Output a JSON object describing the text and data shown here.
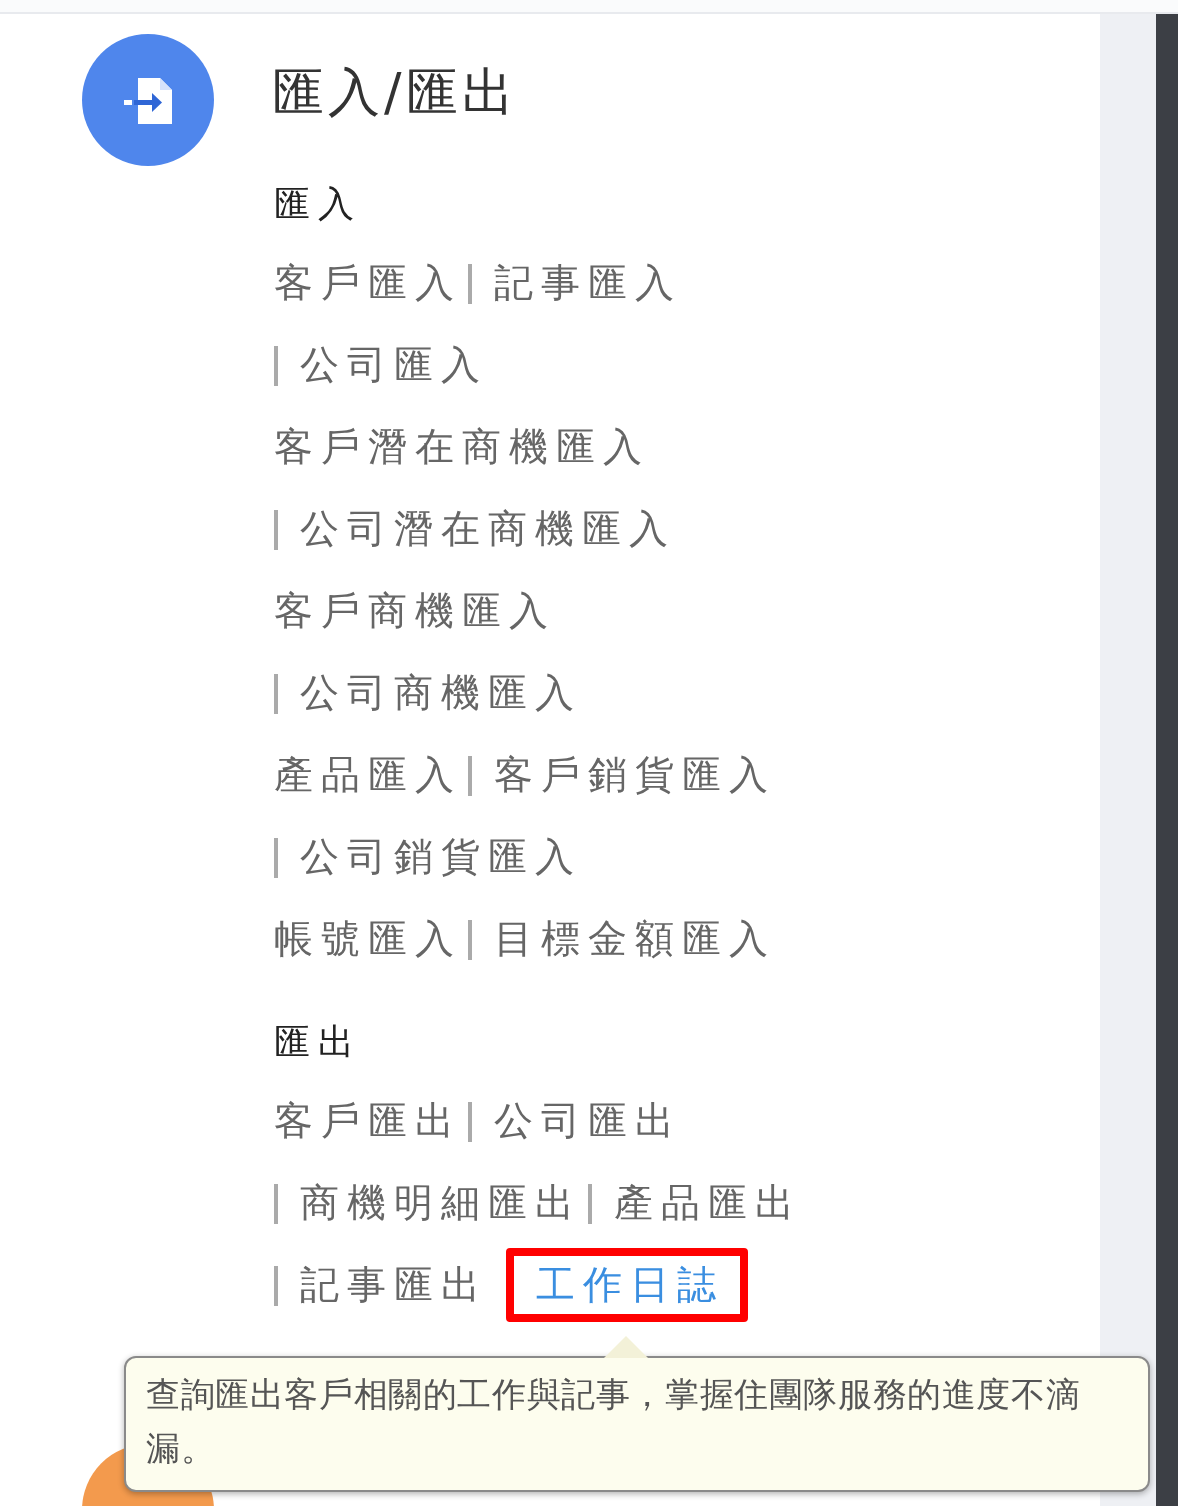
{
  "section": {
    "title": "匯入/匯出",
    "groups": [
      {
        "heading": "匯入",
        "lines": [
          {
            "links": [
              {
                "label": "客戶匯入",
                "bar_before": false,
                "highlighted": false
              },
              {
                "label": "記事匯入",
                "bar_before": true,
                "highlighted": false
              }
            ]
          },
          {
            "links": [
              {
                "label": "公司匯入",
                "bar_before": true,
                "highlighted": false
              }
            ]
          },
          {
            "links": [
              {
                "label": "客戶潛在商機匯入",
                "bar_before": false,
                "highlighted": false
              }
            ]
          },
          {
            "links": [
              {
                "label": "公司潛在商機匯入",
                "bar_before": true,
                "highlighted": false
              }
            ]
          },
          {
            "links": [
              {
                "label": "客戶商機匯入",
                "bar_before": false,
                "highlighted": false
              }
            ]
          },
          {
            "links": [
              {
                "label": "公司商機匯入",
                "bar_before": true,
                "highlighted": false
              }
            ]
          },
          {
            "links": [
              {
                "label": "產品匯入",
                "bar_before": false,
                "highlighted": false
              },
              {
                "label": "客戶銷貨匯入",
                "bar_before": true,
                "highlighted": false
              }
            ]
          },
          {
            "links": [
              {
                "label": "公司銷貨匯入",
                "bar_before": true,
                "highlighted": false
              }
            ]
          },
          {
            "links": [
              {
                "label": "帳號匯入",
                "bar_before": false,
                "highlighted": false
              },
              {
                "label": "目標金額匯入",
                "bar_before": true,
                "highlighted": false
              }
            ]
          }
        ]
      },
      {
        "heading": "匯出",
        "lines": [
          {
            "links": [
              {
                "label": "客戶匯出",
                "bar_before": false,
                "highlighted": false
              },
              {
                "label": "公司匯出",
                "bar_before": true,
                "highlighted": false
              }
            ]
          },
          {
            "links": [
              {
                "label": "商機明細匯出",
                "bar_before": true,
                "highlighted": false
              },
              {
                "label": "產品匯出",
                "bar_before": true,
                "highlighted": false
              }
            ]
          },
          {
            "links": [
              {
                "label": "記事匯出",
                "bar_before": true,
                "highlighted": false
              },
              {
                "label": "工作日誌",
                "bar_before": false,
                "highlighted": true
              }
            ]
          }
        ]
      }
    ]
  },
  "tooltip": {
    "text": "查詢匯出客戶相關的工作與記事，掌握住團隊服務的進度不滴漏。"
  }
}
